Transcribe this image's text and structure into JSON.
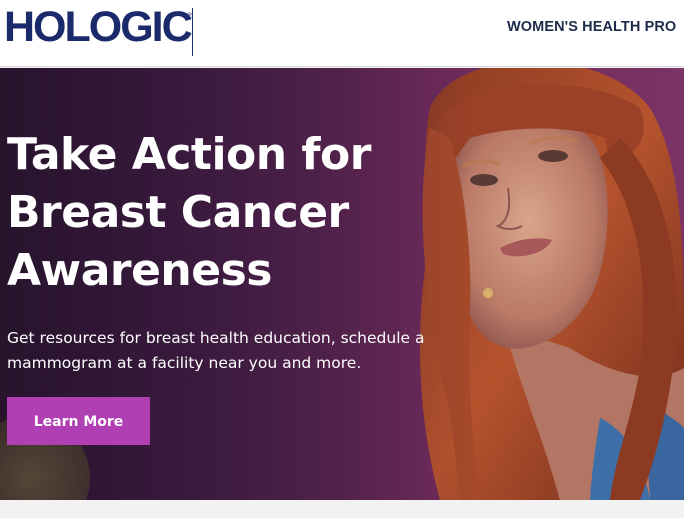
{
  "header": {
    "logo_text": "HOLOGIC",
    "logo_mark": "®",
    "nav_link": "WOMEN'S HEALTH PRO"
  },
  "hero": {
    "title": "Take Action for Breast Cancer Awareness",
    "subtitle": "Get resources for breast health education, schedule a mammogram at a facility near you and more.",
    "cta_label": "Learn More",
    "image_subject": "portrait of a woman with auburn hair and bangs on a purple background"
  },
  "colors": {
    "brand_navy": "#1b2a6b",
    "hero_purple": "#5a244f",
    "cta_magenta": "#b03fb4"
  }
}
